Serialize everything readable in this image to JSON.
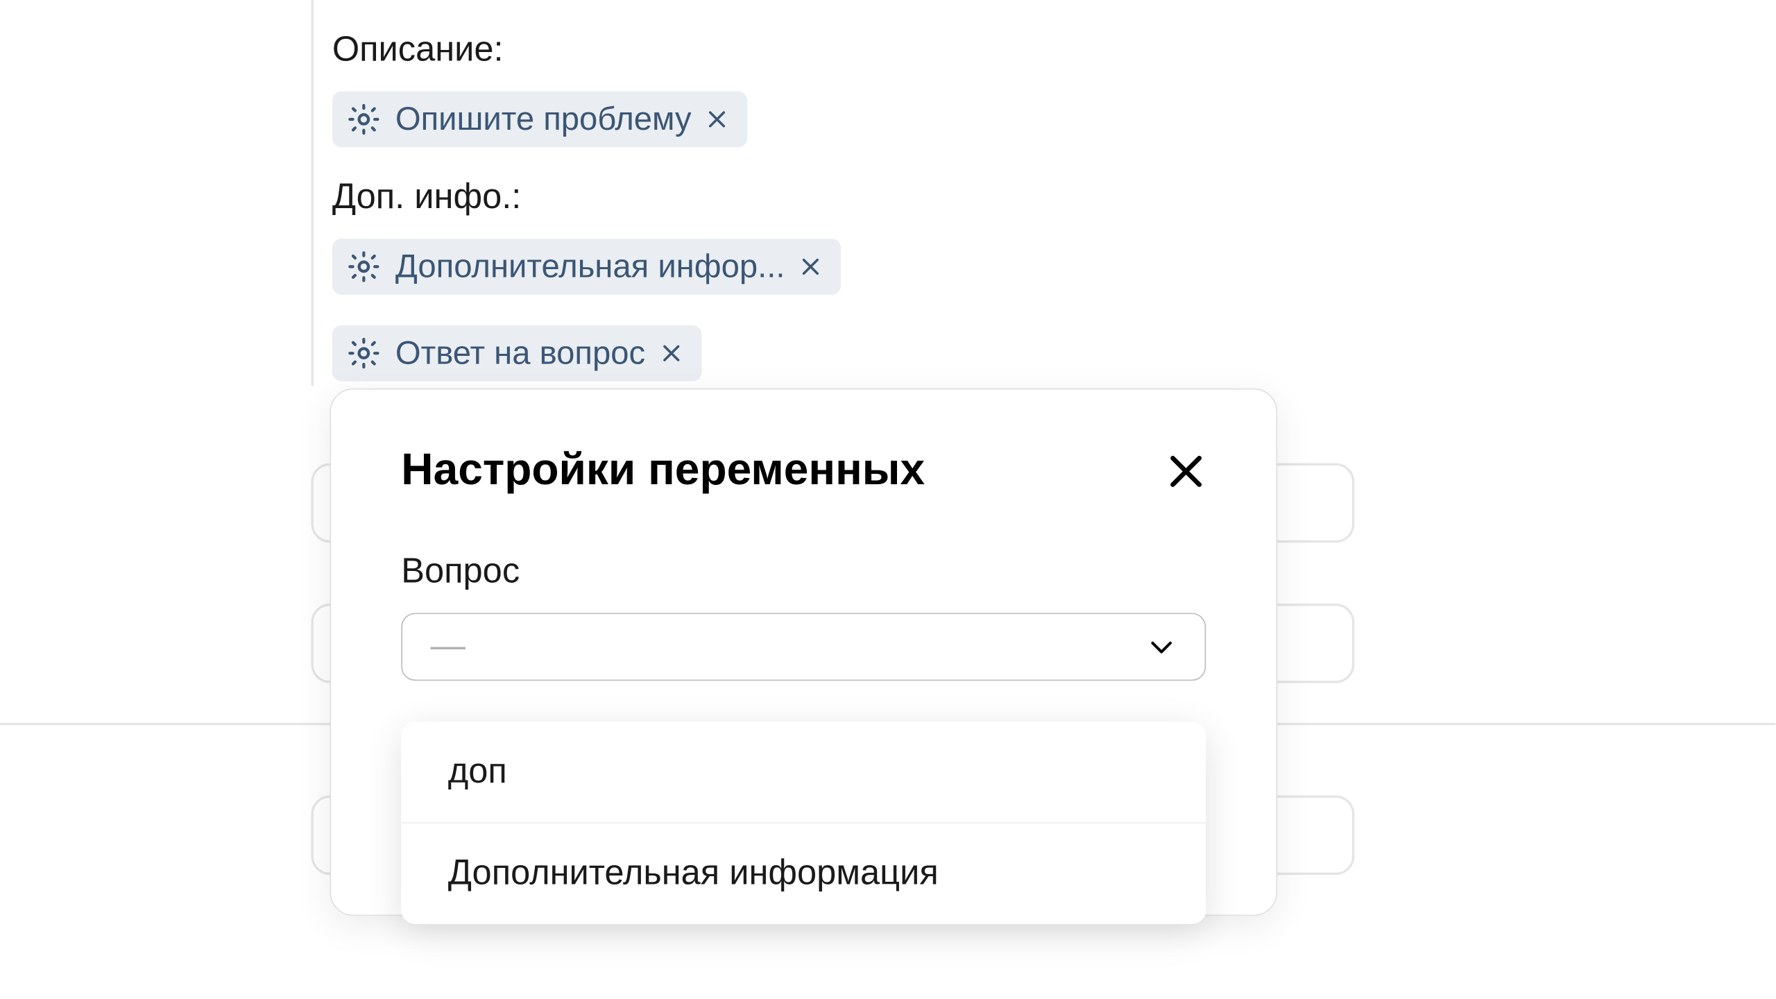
{
  "sections": {
    "description": {
      "label": "Описание:",
      "chips": [
        {
          "text": "Опишите проблему"
        }
      ]
    },
    "extra": {
      "label": "Доп. инфо.:",
      "chips": [
        {
          "text": "Дополнительная инфор..."
        },
        {
          "text": "Ответ на вопрос"
        }
      ]
    }
  },
  "popover": {
    "title": "Настройки переменных",
    "field_label": "Вопрос",
    "select_placeholder": "—"
  },
  "dropdown": {
    "options": [
      "доп",
      "Дополнительная информация"
    ]
  }
}
